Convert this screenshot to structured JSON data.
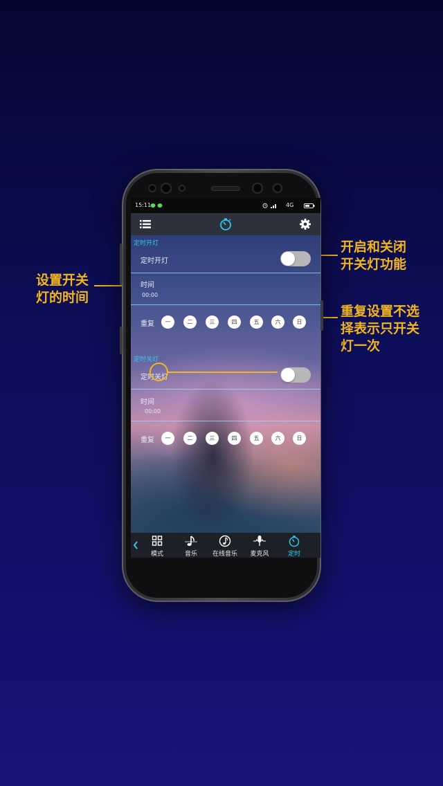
{
  "callouts": {
    "on_off": "开启和关闭\n开关灯功能",
    "time": "设置开关\n灯的时间",
    "repeat": "重复设置不选\n择表示只开关\n灯一次"
  },
  "status_bar": {
    "time": "15:11",
    "network": "4G"
  },
  "header": {
    "menu_icon": "list-icon",
    "center_icon": "timer-icon",
    "settings_icon": "gear-icon"
  },
  "on_section": {
    "title": "定时开灯",
    "toggle_label": "定时开灯",
    "toggle_state": "off",
    "time_label": "时间",
    "time_value": "00:00",
    "repeat_label": "重复",
    "days": [
      "一",
      "二",
      "三",
      "四",
      "五",
      "六",
      "日"
    ]
  },
  "off_section": {
    "title": "定时关灯",
    "toggle_label": "定时关灯",
    "toggle_state": "off",
    "time_label": "时间",
    "time_value": "00:00",
    "repeat_label": "重复",
    "days": [
      "一",
      "二",
      "三",
      "四",
      "五",
      "六",
      "日"
    ]
  },
  "bottom_nav": {
    "back_icon": "chevron-left-icon",
    "items": [
      {
        "label": "模式",
        "icon": "grid-icon"
      },
      {
        "label": "音乐",
        "icon": "music-note-icon"
      },
      {
        "label": "在线音乐",
        "icon": "online-music-icon"
      },
      {
        "label": "麦克风",
        "icon": "microphone-icon"
      },
      {
        "label": "定时",
        "icon": "timer-icon"
      }
    ],
    "active": "定时"
  },
  "colors": {
    "accent": "#31c8ee",
    "callout": "#f2b61f",
    "background": "#0d0e5a"
  }
}
